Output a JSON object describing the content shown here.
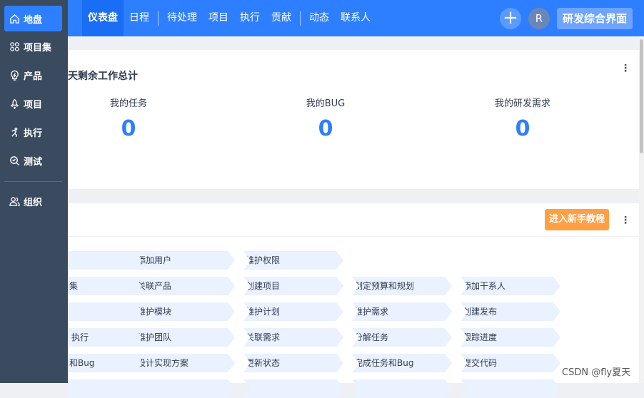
{
  "topnav": {
    "items": [
      "仪表盘",
      "日程",
      "待处理",
      "项目",
      "执行",
      "贡献",
      "动态",
      "联系人"
    ],
    "create_icon": "plus-icon",
    "avatar_letter": "R",
    "view_switch": "研发综合界面"
  },
  "sidebar": {
    "items": [
      {
        "label": "地盘",
        "icon": "home-icon"
      },
      {
        "label": "项目集",
        "icon": "grid-icon"
      },
      {
        "label": "产品",
        "icon": "lightbulb-icon"
      },
      {
        "label": "项目",
        "icon": "rocket-icon"
      },
      {
        "label": "执行",
        "icon": "run-icon"
      },
      {
        "label": "测试",
        "icon": "search-icon"
      },
      {
        "label": "组织",
        "icon": "users-icon"
      }
    ]
  },
  "summary": {
    "title": "天剩余工作总计",
    "stats": [
      {
        "label": "我的任务",
        "value": "0"
      },
      {
        "label": "我的BUG",
        "value": "0"
      },
      {
        "label": "我的研发需求",
        "value": "0"
      }
    ]
  },
  "guide": {
    "button": "进入新手教程",
    "rows": [
      [
        "",
        "添加用户",
        "维护权限"
      ],
      [
        "集",
        "关联产品",
        "创建项目",
        "制定预算和规划",
        "添加干系人"
      ],
      [
        "",
        "维护模块",
        "维护计划",
        "维护需求",
        "创建发布"
      ],
      [
        "执行",
        "维护团队",
        "关联需求",
        "分解任务",
        "跟踪进度"
      ],
      [
        "和Bug",
        "设计实现方案",
        "更新状态",
        "完成任务和Bug",
        "提交代码"
      ]
    ]
  },
  "watermark": "CSDN @fly夏天",
  "colors": {
    "primary": "#2e7fff",
    "sidebar": "#3a4a5f",
    "accent": "#ff9f46"
  }
}
